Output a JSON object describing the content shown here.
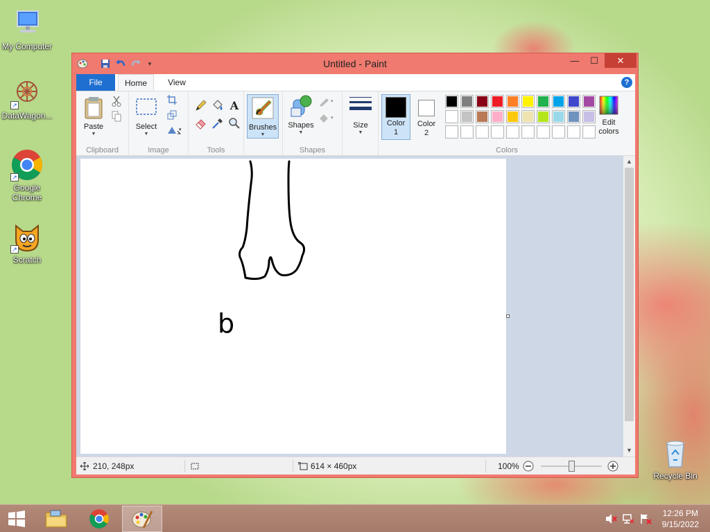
{
  "desktop": {
    "icons": [
      {
        "label": "My Computer",
        "icon": "computer-icon"
      },
      {
        "label": "DataWagon...",
        "icon": "datawagon-icon"
      },
      {
        "label": "Google Chrome",
        "icon": "chrome-icon"
      },
      {
        "label": "Scratch",
        "icon": "scratch-icon"
      },
      {
        "label": "Recycle Bin",
        "icon": "recycle-bin-icon"
      }
    ]
  },
  "window": {
    "title": "Untitled - Paint",
    "controls": {
      "minimize": "—",
      "maximize": "☐",
      "close": "✕"
    }
  },
  "ribbon": {
    "tabs": {
      "file": "File",
      "home": "Home",
      "view": "View"
    },
    "help": "?",
    "groups": {
      "clipboard": {
        "label": "Clipboard",
        "paste": "Paste"
      },
      "image": {
        "label": "Image",
        "select": "Select"
      },
      "tools": {
        "label": "Tools"
      },
      "brushes": {
        "label": "Brushes"
      },
      "shapes": {
        "label": "Shapes",
        "shapes_btn": "Shapes"
      },
      "size": {
        "label": "Size"
      },
      "colors": {
        "label": "Colors",
        "color1": "Color",
        "color1_num": "1",
        "color2": "Color",
        "color2_num": "2",
        "edit": "Edit",
        "edit2": "colors"
      }
    },
    "color1_value": "#000000",
    "color2_value": "#ffffff",
    "palette_row1": [
      "#000000",
      "#7f7f7f",
      "#880015",
      "#ed1c24",
      "#ff7f27",
      "#fff200",
      "#22b14c",
      "#00a2e8",
      "#3f48cc",
      "#a349a4"
    ],
    "palette_row2": [
      "#ffffff",
      "#c3c3c3",
      "#b97a57",
      "#ffaec9",
      "#ffc90e",
      "#efe4b0",
      "#b5e61d",
      "#99d9ea",
      "#7092be",
      "#c8bfe7"
    ],
    "palette_row3": [
      "#ffffff",
      "#ffffff",
      "#ffffff",
      "#ffffff",
      "#ffffff",
      "#ffffff",
      "#ffffff",
      "#ffffff",
      "#ffffff",
      "#ffffff"
    ]
  },
  "canvas": {
    "drawn_text": "b"
  },
  "status": {
    "cursor_pos": "210, 248px",
    "image_size": "614 × 460px",
    "zoom": "100%",
    "zoom_level": 0.5
  },
  "taskbar": {
    "time": "12:26 PM",
    "date": "9/15/2022"
  }
}
